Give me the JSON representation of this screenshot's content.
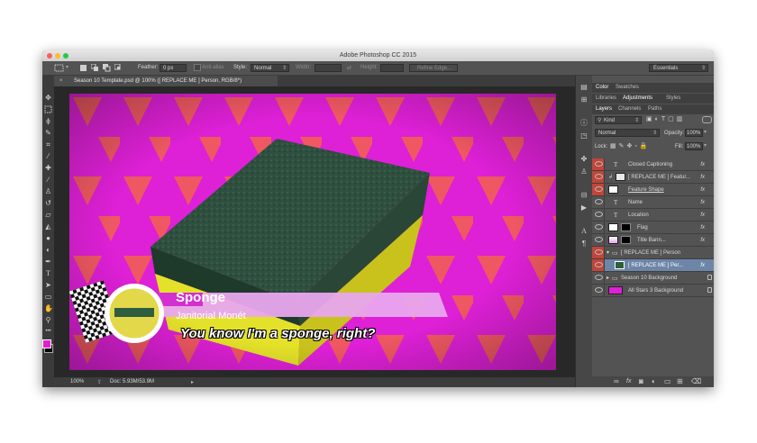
{
  "window": {
    "title": "Adobe Photoshop CC 2015"
  },
  "options_bar": {
    "feather_label": "Feather:",
    "feather_value": "0 px",
    "antialias_label": "Anti-alias",
    "style_label": "Style:",
    "style_value": "Normal",
    "width_label": "Width:",
    "height_label": "Height:",
    "refine_edge": "Refine Edge...",
    "workspace": "Essentials"
  },
  "document": {
    "tab_label": "Season 10 Template.psd @ 100% ([ REPLACE ME ] Person, RGB/8*)",
    "zoom": "100%",
    "doc_info": "Doc: 5.93M/53.9M"
  },
  "lower_third": {
    "name": "Sponge",
    "location": "Janitorial Monét",
    "caption": "You know I'm a sponge, right?"
  },
  "colors": {
    "canvas_bg": "#de20d6",
    "triangle": "#f2624e",
    "foreground": "#e01fcf",
    "background": "#000000",
    "layer_visibility_highlight": "#c0463a",
    "selected_layer": "#6d86a8"
  },
  "panels": {
    "top_tabs": [
      "Color",
      "Swatches"
    ],
    "mid_tabs": [
      "Libraries",
      "Adjustments",
      "Styles"
    ],
    "layers_tabs": [
      "Layers",
      "Channels",
      "Paths"
    ],
    "kind_label": "Kind",
    "blend_mode": "Normal",
    "opacity_label": "Opacity:",
    "opacity_value": "100%",
    "lock_label": "Lock:",
    "fill_label": "Fill:",
    "fill_value": "100%"
  },
  "layers": [
    {
      "name": "Closed Captioning",
      "fx": "fx"
    },
    {
      "name": "[ REPLACE ME ] Featur...",
      "fx": "fx"
    },
    {
      "name": "Feature Shape",
      "fx": "fx"
    },
    {
      "name": "Name",
      "fx": "fx"
    },
    {
      "name": "Location",
      "fx": "fx"
    },
    {
      "name": "Flag",
      "fx": "fx"
    },
    {
      "name": "Title Bann...",
      "fx": "fx"
    },
    {
      "name": "[ REPLACE ME ] Person",
      "fx": ""
    },
    {
      "name": "[ REPLACE ME ] Per...",
      "fx": "fx"
    },
    {
      "name": "Season 10 Background",
      "fx": ""
    },
    {
      "name": "All Stars 3 Background",
      "fx": ""
    }
  ]
}
